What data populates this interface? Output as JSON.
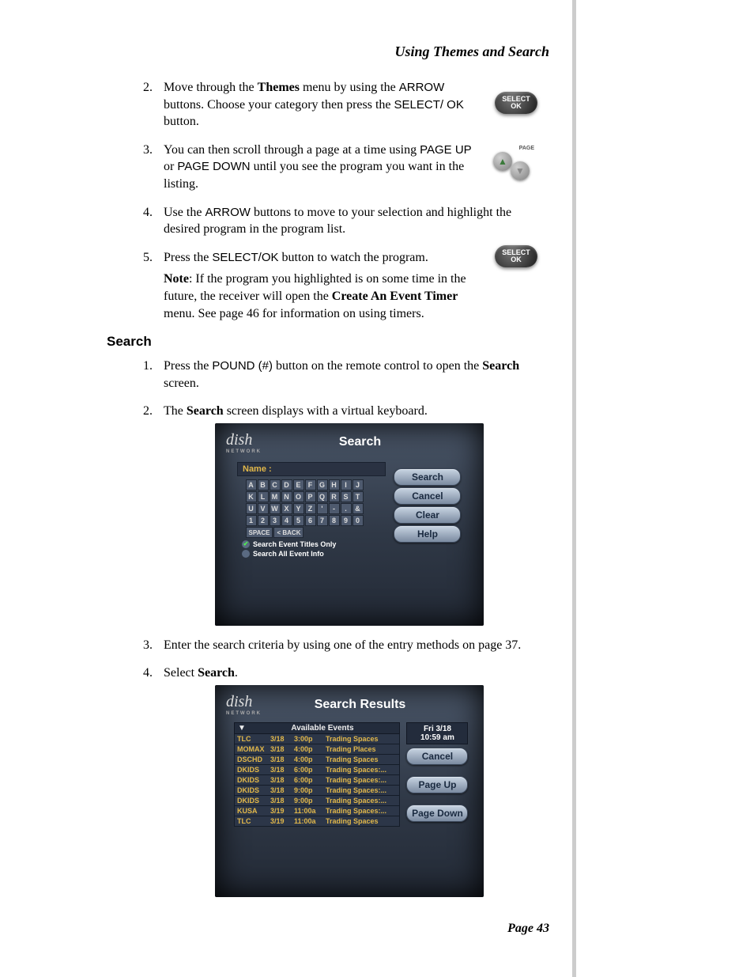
{
  "header": {
    "title": "Using Themes and Search"
  },
  "steps_top": [
    {
      "pre": "Move through the ",
      "b1": "Themes",
      "mid": " menu by using the ",
      "k1": "ARROW",
      "mid2": " buttons. Choose your category then press the ",
      "k2": "SELECT/ OK",
      "post": " button."
    },
    {
      "pre": "You can then scroll through a page at a time using ",
      "k1": "PAGE UP",
      "mid": " or ",
      "k2": "PAGE DOWN",
      "post": " until you see the program you want in the listing."
    },
    {
      "pre": "Use the ",
      "k1": "ARROW",
      "post": " buttons to move to your selection and highlight the desired program in the program list."
    },
    {
      "pre": "Press the ",
      "k1": "SELECT/OK",
      "post": " button to watch the program.",
      "note_label": "Note",
      "note": ": If the program you highlighted is on some time in the future, the receiver will open the ",
      "note_b": "Create An Event Timer",
      "note_tail": " menu. See page 46 for information on using timers."
    }
  ],
  "section": {
    "search": "Search"
  },
  "steps_search": [
    {
      "pre": "Press the ",
      "k1": "POUND (#)",
      "mid": " button on the remote control to open the ",
      "b1": "Search",
      "post": " screen."
    },
    {
      "pre": "The ",
      "b1": "Search",
      "post": " screen displays with a virtual keyboard."
    },
    {
      "text": "Enter the search criteria by using one of the entry methods on page 37."
    },
    {
      "pre": "Select ",
      "b1": "Search",
      "post": "."
    }
  ],
  "tv_search": {
    "logo": "dish",
    "logo_sub": "NETWORK",
    "title": "Search",
    "name_label": "Name :",
    "keys": [
      [
        "A",
        "B",
        "C",
        "D",
        "E",
        "F",
        "G",
        "H",
        "I",
        "J"
      ],
      [
        "K",
        "L",
        "M",
        "N",
        "O",
        "P",
        "Q",
        "R",
        "S",
        "T"
      ],
      [
        "U",
        "V",
        "W",
        "X",
        "Y",
        "Z",
        "'",
        "-",
        ".",
        "&"
      ],
      [
        "1",
        "2",
        "3",
        "4",
        "5",
        "6",
        "7",
        "8",
        "9",
        "0"
      ]
    ],
    "space": "SPACE",
    "back": "< BACK",
    "radio1": "Search Event Titles Only",
    "radio2": "Search All Event Info",
    "buttons": [
      "Search",
      "Cancel",
      "Clear",
      "Help"
    ]
  },
  "tv_results": {
    "logo": "dish",
    "logo_sub": "NETWORK",
    "title": "Search Results",
    "avail_head": "Available Events",
    "rows": [
      {
        "ch": "TLC",
        "date": "3/18",
        "time": "3:00p",
        "prog": "Trading Spaces"
      },
      {
        "ch": "MOMAX",
        "date": "3/18",
        "time": "4:00p",
        "prog": "Trading Places"
      },
      {
        "ch": "DSCHD",
        "date": "3/18",
        "time": "4:00p",
        "prog": "Trading Spaces"
      },
      {
        "ch": "DKIDS",
        "date": "3/18",
        "time": "6:00p",
        "prog": "Trading Spaces:..."
      },
      {
        "ch": "DKIDS",
        "date": "3/18",
        "time": "6:00p",
        "prog": "Trading Spaces:..."
      },
      {
        "ch": "DKIDS",
        "date": "3/18",
        "time": "9:00p",
        "prog": "Trading Spaces:..."
      },
      {
        "ch": "DKIDS",
        "date": "3/18",
        "time": "9:00p",
        "prog": "Trading Spaces:..."
      },
      {
        "ch": "KUSA",
        "date": "3/19",
        "time": "11:00a",
        "prog": "Trading Spaces:..."
      },
      {
        "ch": "TLC",
        "date": "3/19",
        "time": "11:00a",
        "prog": "Trading Spaces"
      }
    ],
    "datetime_l1": "Fri 3/18",
    "datetime_l2": "10:59 am",
    "buttons": [
      "Cancel",
      "Page Up",
      "Page Down"
    ]
  },
  "remote": {
    "select": "SELECT",
    "ok": "OK",
    "page": "PAGE"
  },
  "footer": {
    "page": "Page 43"
  }
}
